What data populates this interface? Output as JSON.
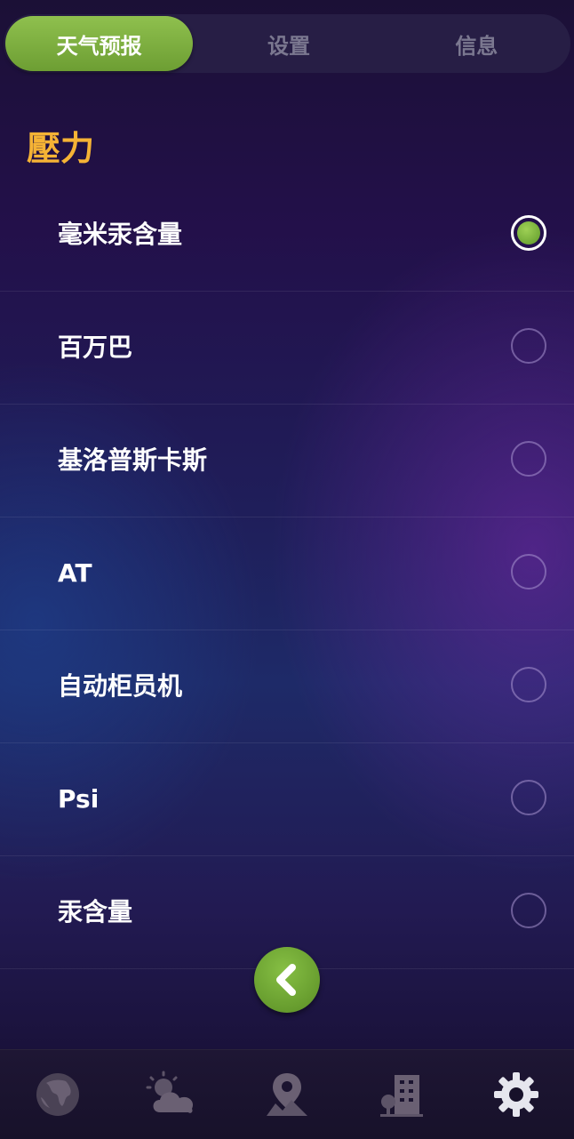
{
  "tabs": [
    {
      "label": "天气预报",
      "active": true
    },
    {
      "label": "设置",
      "active": false
    },
    {
      "label": "信息",
      "active": false
    }
  ],
  "section": {
    "title": "壓力"
  },
  "options": [
    {
      "label": "毫米汞含量",
      "selected": true
    },
    {
      "label": "百万巴",
      "selected": false
    },
    {
      "label": "基洛普斯卡斯",
      "selected": false
    },
    {
      "label": "AT",
      "selected": false
    },
    {
      "label": "自动柜员机",
      "selected": false
    },
    {
      "label": "Psi",
      "selected": false
    },
    {
      "label": "汞含量",
      "selected": false
    }
  ],
  "back_button": {
    "icon": "chevron-left-icon"
  },
  "bottom_nav": [
    {
      "icon": "globe-icon",
      "active": false
    },
    {
      "icon": "cloud-sun-icon",
      "active": false
    },
    {
      "icon": "map-pin-icon",
      "active": false
    },
    {
      "icon": "city-icon",
      "active": false
    },
    {
      "icon": "gear-icon",
      "active": true
    }
  ],
  "colors": {
    "accent": "#f5b335",
    "green": "#7cb33c"
  }
}
